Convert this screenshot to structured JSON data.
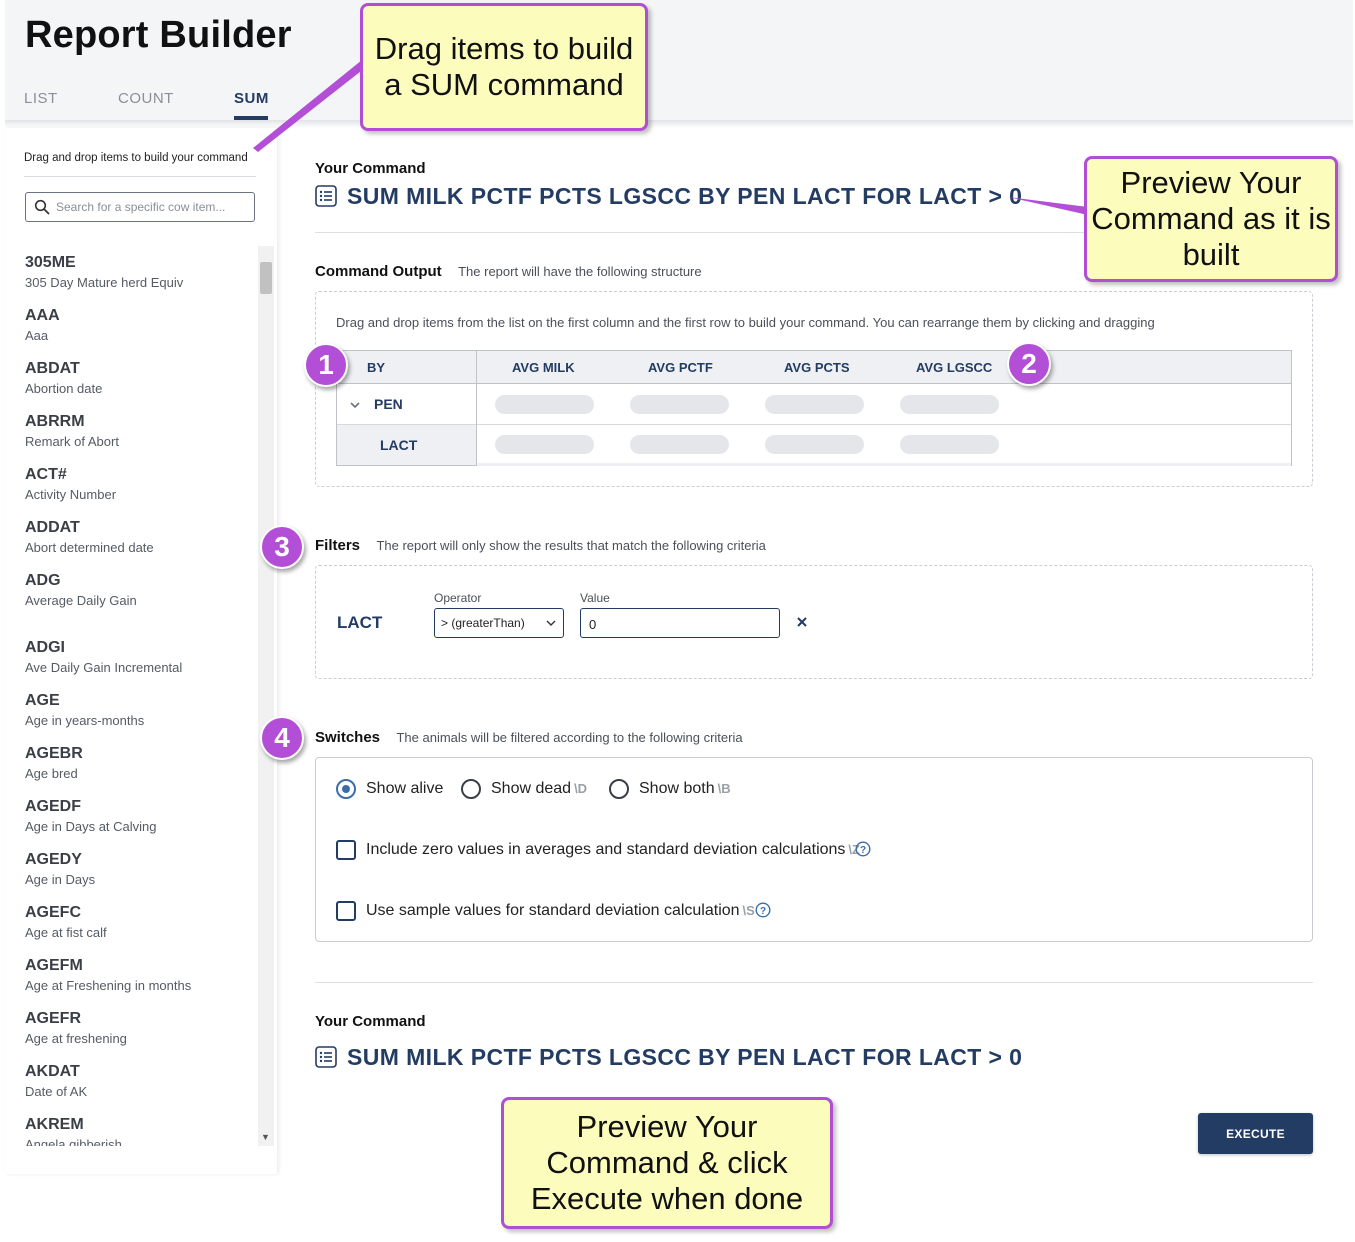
{
  "app": {
    "title": "Report Builder"
  },
  "tabs": [
    {
      "label": "LIST",
      "active": false
    },
    {
      "label": "COUNT",
      "active": false
    },
    {
      "label": "SUM",
      "active": true
    }
  ],
  "sidebar": {
    "hint": "Drag and drop items to build your command",
    "search_placeholder": "Search for a specific cow item...",
    "items": [
      {
        "code": "305ME",
        "desc": "305 Day Mature herd Equiv"
      },
      {
        "code": "AAA",
        "desc": "Aaa"
      },
      {
        "code": "ABDAT",
        "desc": "Abortion date"
      },
      {
        "code": "ABRRM",
        "desc": "Remark of Abort"
      },
      {
        "code": "ACT#",
        "desc": "Activity Number"
      },
      {
        "code": "ADDAT",
        "desc": "Abort determined date"
      },
      {
        "code": "ADG",
        "desc": "Average Daily Gain"
      },
      {
        "code": "ADGI",
        "desc": "Ave Daily Gain Incremental"
      },
      {
        "code": "AGE",
        "desc": "Age in years-months"
      },
      {
        "code": "AGEBR",
        "desc": "Age bred"
      },
      {
        "code": "AGEDF",
        "desc": "Age in Days at Calving"
      },
      {
        "code": "AGEDY",
        "desc": "Age in Days"
      },
      {
        "code": "AGEFC",
        "desc": "Age at fist calf"
      },
      {
        "code": "AGEFM",
        "desc": "Age at Freshening in months"
      },
      {
        "code": "AGEFR",
        "desc": "Age at freshening"
      },
      {
        "code": "AKDAT",
        "desc": "Date of AK"
      },
      {
        "code": "AKREM",
        "desc": "Angela gibberish"
      }
    ]
  },
  "command": {
    "heading": "Your Command",
    "text": "SUM MILK PCTF PCTS LGSCC BY PEN LACT FOR LACT > 0"
  },
  "output": {
    "heading": "Command Output",
    "subheading": "The report will have the following structure",
    "instructions": "Drag and drop items from the list on the first column and the first row to build your command. You can rearrange them by clicking and dragging",
    "by_label": "BY",
    "columns": [
      "AVG MILK",
      "AVG PCTF",
      "AVG PCTS",
      "AVG LGSCC"
    ],
    "rows": [
      "PEN",
      "LACT"
    ]
  },
  "filters": {
    "heading": "Filters",
    "subheading": "The report will only show the results that match the following criteria",
    "items": [
      {
        "field": "LACT",
        "operator_label": "Operator",
        "operator": "> (greaterThan)",
        "value_label": "Value",
        "value": "0"
      }
    ]
  },
  "switches": {
    "heading": "Switches",
    "subheading": "The animals will be filtered according to the following criteria",
    "radios": [
      {
        "label": "Show alive",
        "key": "",
        "selected": true
      },
      {
        "label": "Show dead",
        "key": "\\D",
        "selected": false
      },
      {
        "label": "Show both",
        "key": "\\B",
        "selected": false
      }
    ],
    "checkboxes": [
      {
        "label": "Include zero values in averages and standard deviation calculations",
        "key": "\\Z",
        "checked": false
      },
      {
        "label": "Use sample values for standard deviation calculation",
        "key": "\\S",
        "checked": false
      }
    ]
  },
  "execute_label": "EXECUTE",
  "annotations": {
    "callout_drag": "Drag items to build a SUM command",
    "callout_preview": "Preview Your Command as it is built",
    "callout_execute": "Preview Your Command & click Execute when done",
    "badges": [
      "1",
      "2",
      "3",
      "4"
    ],
    "accent_color": "#b34fd6",
    "callout_bg": "#fcfcbd"
  },
  "colors": {
    "brand": "#233c63",
    "radio_selected": "#3b6ea8"
  }
}
